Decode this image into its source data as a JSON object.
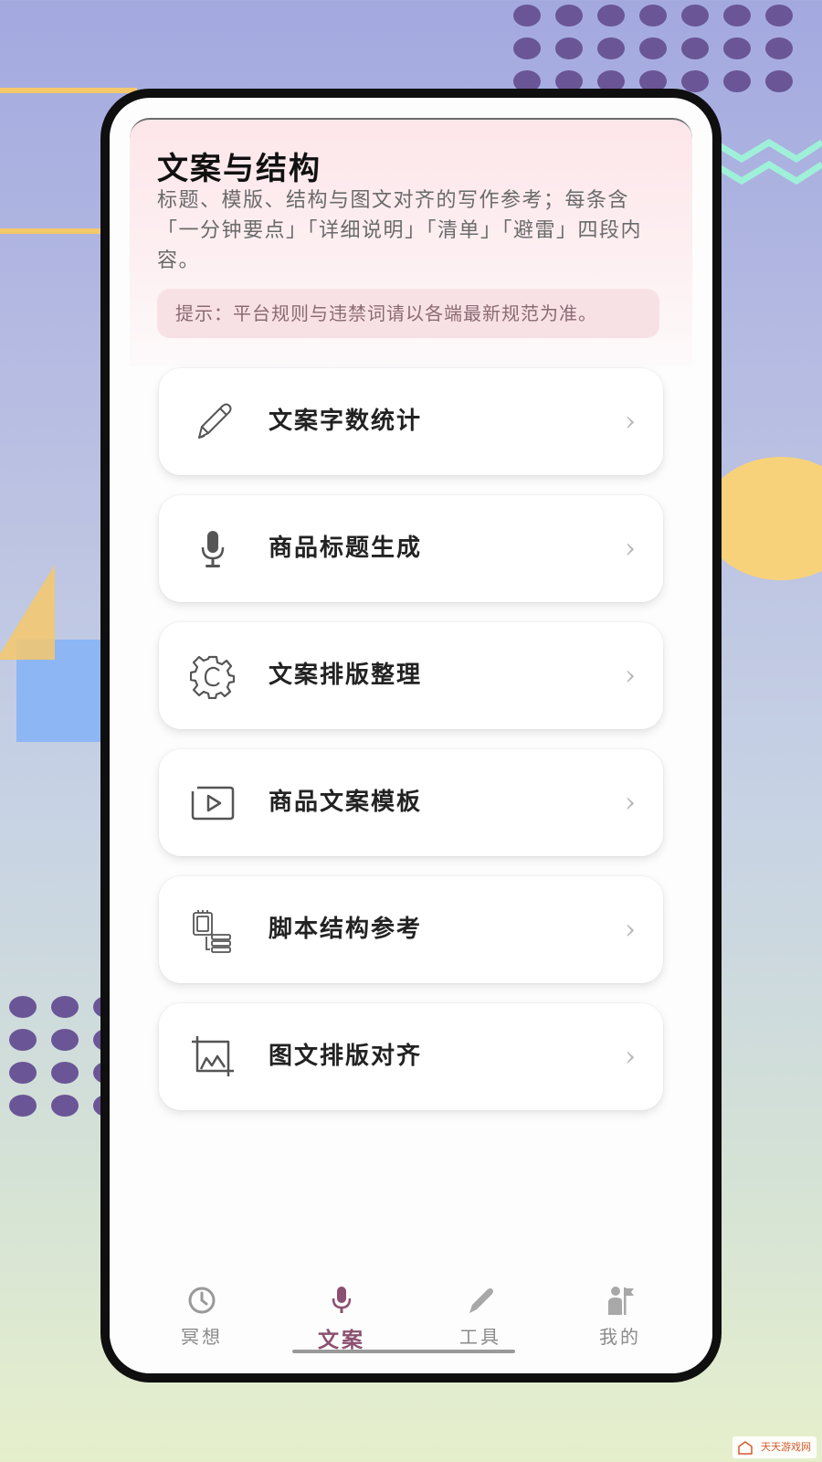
{
  "header": {
    "title": "文案与结构",
    "description": "标题、模版、结构与图文对齐的写作参考；每条含「一分钟要点」「详细说明」「清单」「避雷」四段内容。",
    "tip": "提示：平台规则与违禁词请以各端最新规范为准。"
  },
  "menu": [
    {
      "label": "文案字数统计",
      "icon": "pencil-icon"
    },
    {
      "label": "商品标题生成",
      "icon": "microphone-icon"
    },
    {
      "label": "文案排版整理",
      "icon": "gear-icon"
    },
    {
      "label": "商品文案模板",
      "icon": "play-icon"
    },
    {
      "label": "脚本结构参考",
      "icon": "document-list-icon"
    },
    {
      "label": "图文排版对齐",
      "icon": "image-crop-icon"
    }
  ],
  "tabs": [
    {
      "label": "冥想",
      "icon": "clock-icon",
      "active": false
    },
    {
      "label": "文案",
      "icon": "microphone-icon",
      "active": true
    },
    {
      "label": "工具",
      "icon": "pencil-icon",
      "active": false
    },
    {
      "label": "我的",
      "icon": "user-flag-icon",
      "active": false
    }
  ],
  "colors": {
    "accent": "#8b5070",
    "header_bg": "#fde6ea",
    "tip_bg": "#f8e1e5"
  },
  "watermark": "天天游戏网"
}
